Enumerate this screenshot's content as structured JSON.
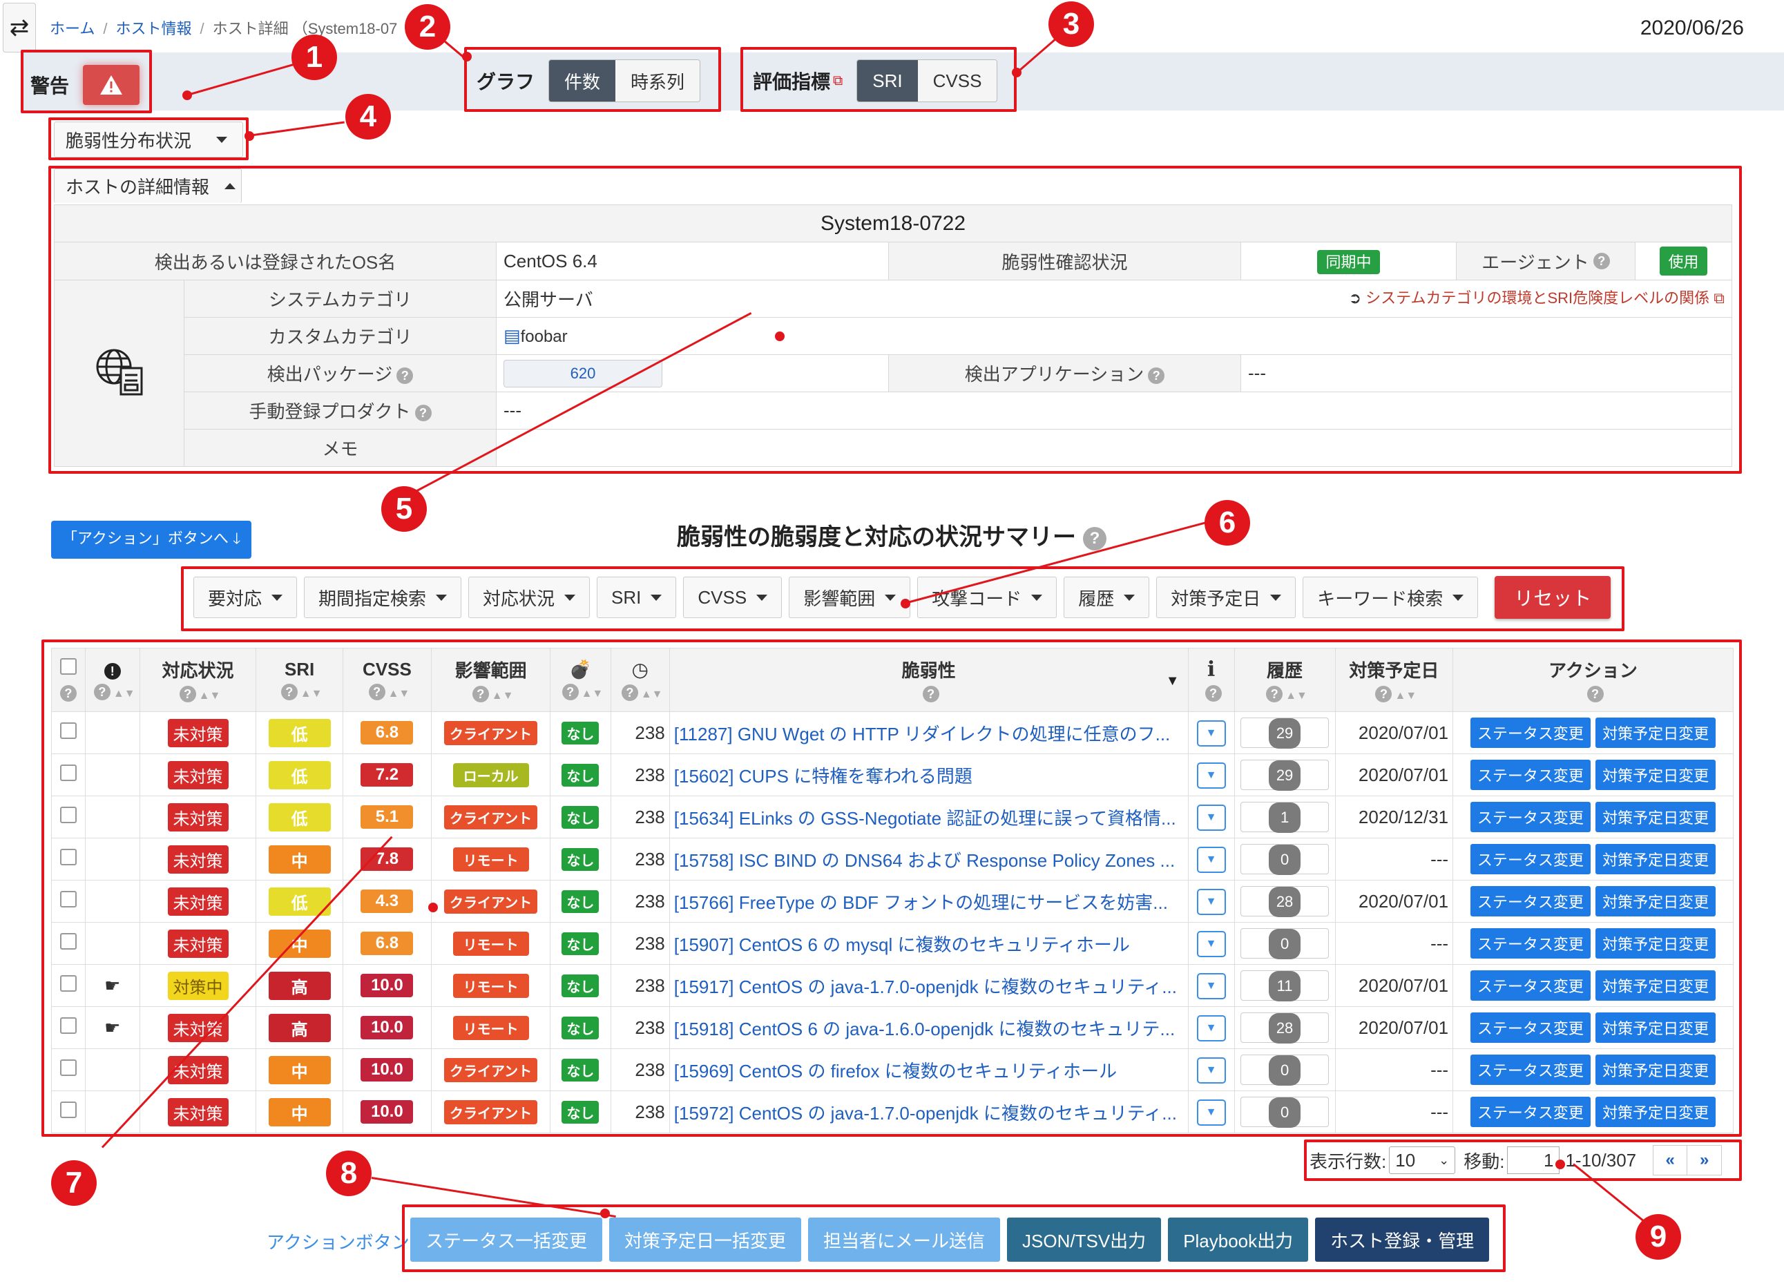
{
  "nav": {
    "swap_icon": "swap-icon",
    "breadcrumb": [
      "ホーム",
      "ホスト情報",
      "ホスト詳細 （System18-07"
    ],
    "date": "2020/06/26"
  },
  "toolbar": {
    "warning_label": "警告",
    "graph_label": "グラフ",
    "graph_options": [
      "件数",
      "時系列"
    ],
    "graph_selected": "件数",
    "metric_label": "評価指標",
    "metric_options": [
      "SRI",
      "CVSS"
    ],
    "metric_selected": "SRI"
  },
  "distribution_dropdown": "脆弱性分布状況",
  "host_detail": {
    "toggle_label": "ホストの詳細情報",
    "host_name": "System18-0722",
    "os_label": "検出あるいは登録されたOS名",
    "os_value": "CentOS 6.4",
    "vuln_status_label": "脆弱性確認状況",
    "vuln_status_value": "同期中",
    "agent_label": "エージェント",
    "agent_value": "使用",
    "system_category_label": "システムカテゴリ",
    "system_category_value": "公開サーバ",
    "system_category_link": "システムカテゴリの環境とSRI危険度レベルの関係",
    "custom_category_label": "カスタムカテゴリ",
    "custom_category_value": "foobar",
    "packages_label": "検出パッケージ",
    "packages_value": "620",
    "apps_label": "検出アプリケーション",
    "apps_value": "---",
    "manual_products_label": "手動登録プロダクト",
    "manual_products_value": "---",
    "memo_label": "メモ"
  },
  "action_jump": "「アクション」ボタンへ",
  "summary_title": "脆弱性の脆弱度と対応の状況サマリー",
  "filters": [
    "要対応",
    "期間指定検索",
    "対応状況",
    "SRI",
    "CVSS",
    "影響範囲",
    "攻撃コード",
    "履歴",
    "対策予定日",
    "キーワード検索"
  ],
  "reset_label": "リセット",
  "table": {
    "headers": {
      "status": "対応状況",
      "sri": "SRI",
      "cvss": "CVSS",
      "scope": "影響範囲",
      "vuln": "脆弱性",
      "info": "i",
      "history": "履歴",
      "plan": "対策予定日",
      "action": "アクション"
    },
    "action_status": "ステータス変更",
    "action_plan": "対策予定日変更",
    "rows": [
      {
        "flag": "",
        "status": "未対策",
        "sri": "低",
        "cvss": "6.8",
        "scope": "クライアント",
        "exploit": "なし",
        "days": "238",
        "vuln": "[11287] GNU Wget の HTTP リダイレクトの処理に任意のフ...",
        "history": "29",
        "plan": "2020/07/01"
      },
      {
        "flag": "",
        "status": "未対策",
        "sri": "低",
        "cvss": "7.2",
        "scope": "ローカル",
        "exploit": "なし",
        "days": "238",
        "vuln": "[15602] CUPS に特権を奪われる問題",
        "history": "29",
        "plan": "2020/07/01"
      },
      {
        "flag": "",
        "status": "未対策",
        "sri": "低",
        "cvss": "5.1",
        "scope": "クライアント",
        "exploit": "なし",
        "days": "238",
        "vuln": "[15634] ELinks の GSS-Negotiate 認証の処理に誤って資格情...",
        "history": "1",
        "plan": "2020/12/31"
      },
      {
        "flag": "",
        "status": "未対策",
        "sri": "中",
        "cvss": "7.8",
        "scope": "リモート",
        "exploit": "なし",
        "days": "238",
        "vuln": "[15758] ISC BIND の DNS64 および Response Policy Zones ...",
        "history": "0",
        "plan": "---"
      },
      {
        "flag": "",
        "status": "未対策",
        "sri": "低",
        "cvss": "4.3",
        "scope": "クライアント",
        "exploit": "なし",
        "days": "238",
        "vuln": "[15766] FreeType の BDF フォントの処理にサービスを妨害...",
        "history": "28",
        "plan": "2020/07/01"
      },
      {
        "flag": "",
        "status": "未対策",
        "sri": "中",
        "cvss": "6.8",
        "scope": "リモート",
        "exploit": "なし",
        "days": "238",
        "vuln": "[15907] CentOS 6 の mysql に複数のセキュリティホール",
        "history": "0",
        "plan": "---"
      },
      {
        "flag": "hand",
        "status": "対策中",
        "sri": "高",
        "cvss": "10.0",
        "scope": "リモート",
        "exploit": "なし",
        "days": "238",
        "vuln": "[15917] CentOS の java-1.7.0-openjdk に複数のセキュリティ...",
        "history": "11",
        "plan": "2020/07/01"
      },
      {
        "flag": "hand",
        "status": "未対策",
        "sri": "高",
        "cvss": "10.0",
        "scope": "リモート",
        "exploit": "なし",
        "days": "238",
        "vuln": "[15918] CentOS 6 の java-1.6.0-openjdk に複数のセキュリテ...",
        "history": "28",
        "plan": "2020/07/01"
      },
      {
        "flag": "",
        "status": "未対策",
        "sri": "中",
        "cvss": "10.0",
        "scope": "クライアント",
        "exploit": "なし",
        "days": "238",
        "vuln": "[15969] CentOS の firefox に複数のセキュリティホール",
        "history": "0",
        "plan": "---"
      },
      {
        "flag": "",
        "status": "未対策",
        "sri": "中",
        "cvss": "10.0",
        "scope": "クライアント",
        "exploit": "なし",
        "days": "238",
        "vuln": "[15972] CentOS の java-1.7.0-openjdk に複数のセキュリティ...",
        "history": "0",
        "plan": "---"
      }
    ]
  },
  "pager": {
    "rows_label": "表示行数:",
    "rows_value": "10",
    "goto_label": "移動:",
    "goto_value": "1",
    "range": "1-10/307",
    "prev": "«",
    "next": "»"
  },
  "bottom": {
    "label": "アクションボタン",
    "buttons": [
      "ステータス一括変更",
      "対策予定日一括変更",
      "担当者にメール送信",
      "JSON/TSV出力",
      "Playbook出力",
      "ホスト登録・管理"
    ]
  },
  "callouts": [
    "1",
    "2",
    "3",
    "4",
    "5",
    "6",
    "7",
    "8",
    "9"
  ]
}
